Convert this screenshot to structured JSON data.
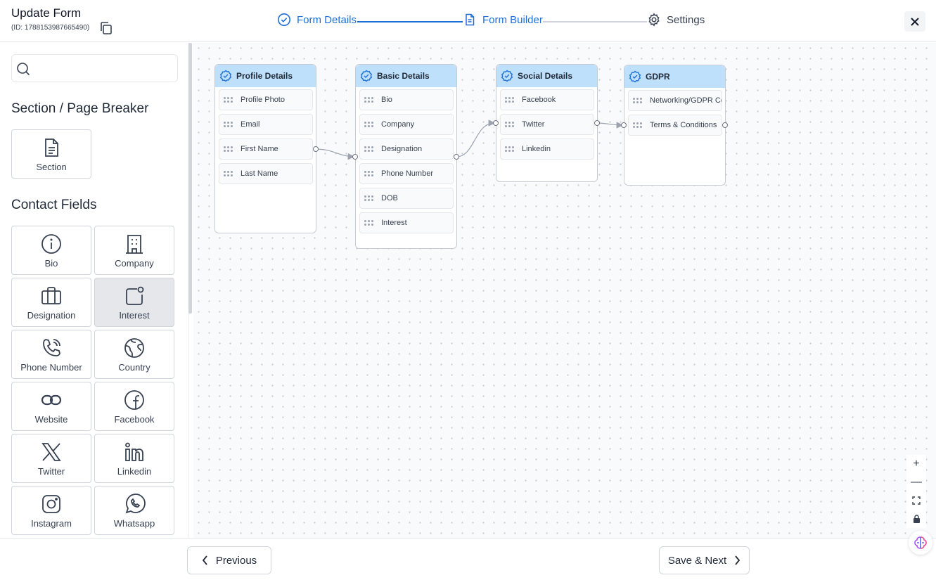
{
  "header": {
    "title": "Update Form",
    "form_id": "(ID: 1788153987665490)",
    "steps": [
      {
        "label": "Form Details",
        "state": "completed"
      },
      {
        "label": "Form Builder",
        "state": "active"
      },
      {
        "label": "Settings",
        "state": "inactive"
      }
    ]
  },
  "sidebar": {
    "search_placeholder": "",
    "section_heading": "Section / Page Breaker",
    "section_tile": {
      "label": "Section",
      "icon": "document-icon"
    },
    "contact_heading": "Contact Fields",
    "contact_tiles": [
      {
        "label": "Bio",
        "icon": "info-icon"
      },
      {
        "label": "Company",
        "icon": "building-icon"
      },
      {
        "label": "Designation",
        "icon": "briefcase-icon"
      },
      {
        "label": "Interest",
        "icon": "interest-icon",
        "selected": true
      },
      {
        "label": "Phone Number",
        "icon": "phone-icon"
      },
      {
        "label": "Country",
        "icon": "globe-icon"
      },
      {
        "label": "Website",
        "icon": "link-icon"
      },
      {
        "label": "Facebook",
        "icon": "facebook-icon"
      },
      {
        "label": "Twitter",
        "icon": "x-twitter-icon"
      },
      {
        "label": "Linkedin",
        "icon": "linkedin-icon"
      },
      {
        "label": "Instagram",
        "icon": "instagram-icon"
      },
      {
        "label": "Whatsapp",
        "icon": "whatsapp-icon"
      }
    ]
  },
  "canvas": {
    "nodes": [
      {
        "title": "Profile Details",
        "fields": [
          "Profile Photo",
          "Email",
          "First Name",
          "Last Name"
        ]
      },
      {
        "title": "Basic Details",
        "fields": [
          "Bio",
          "Company",
          "Designation",
          "Phone Number",
          "DOB",
          "Interest"
        ]
      },
      {
        "title": "Social Details",
        "fields": [
          "Facebook",
          "Twitter",
          "Linkedin"
        ]
      },
      {
        "title": "GDPR",
        "fields": [
          "Networking/GDPR Consent",
          "Terms & Conditions"
        ]
      }
    ],
    "zoom_controls": {
      "zoom_in": "+",
      "zoom_out": "—"
    }
  },
  "footer": {
    "previous_label": "Previous",
    "next_label": "Save & Next"
  },
  "colors": {
    "accent": "#1d6fd8",
    "node_header": "#bfe0fb"
  }
}
